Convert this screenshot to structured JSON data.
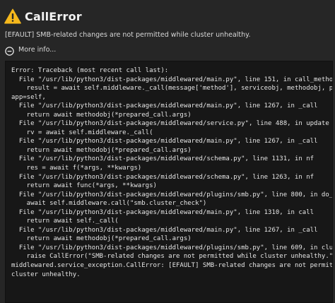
{
  "dialog": {
    "title": "CallError",
    "title_icon": "warning-triangle-icon",
    "message": "[EFAULT] SMB-related changes are not permitted while cluster unhealthy.",
    "more_info": {
      "icon": "minus-circle-icon",
      "label": "More info..."
    },
    "traceback": "Error: Traceback (most recent call last):\n  File \"/usr/lib/python3/dist-packages/middlewared/main.py\", line 151, in call_method\n    result = await self.middleware._call(message['method'], serviceobj, methodobj, params,\napp=self,\n  File \"/usr/lib/python3/dist-packages/middlewared/main.py\", line 1267, in _call\n    return await methodobj(*prepared_call.args)\n  File \"/usr/lib/python3/dist-packages/middlewared/service.py\", line 488, in update\n    rv = await self.middleware._call(\n  File \"/usr/lib/python3/dist-packages/middlewared/main.py\", line 1267, in _call\n    return await methodobj(*prepared_call.args)\n  File \"/usr/lib/python3/dist-packages/middlewared/schema.py\", line 1131, in nf\n    res = await f(*args, **kwargs)\n  File \"/usr/lib/python3/dist-packages/middlewared/schema.py\", line 1263, in nf\n    return await func(*args, **kwargs)\n  File \"/usr/lib/python3/dist-packages/middlewared/plugins/smb.py\", line 800, in do_update\n    await self.middleware.call(\"smb.cluster_check\")\n  File \"/usr/lib/python3/dist-packages/middlewared/main.py\", line 1310, in call\n    return await self._call(\n  File \"/usr/lib/python3/dist-packages/middlewared/main.py\", line 1267, in _call\n    return await methodobj(*prepared_call.args)\n  File \"/usr/lib/python3/dist-packages/middlewared/plugins/smb.py\", line 609, in cluster_check\n    raise CallError(\"SMB-related changes are not permitted while cluster unhealthy.\")\nmiddlewared.service_exception.CallError: [EFAULT] SMB-related changes are not permitted while\ncluster unhealthy."
  },
  "colors": {
    "background": "#262626",
    "trace_background": "#171717",
    "warning_fill": "#f5b81c",
    "text": "#e6e6e6"
  }
}
